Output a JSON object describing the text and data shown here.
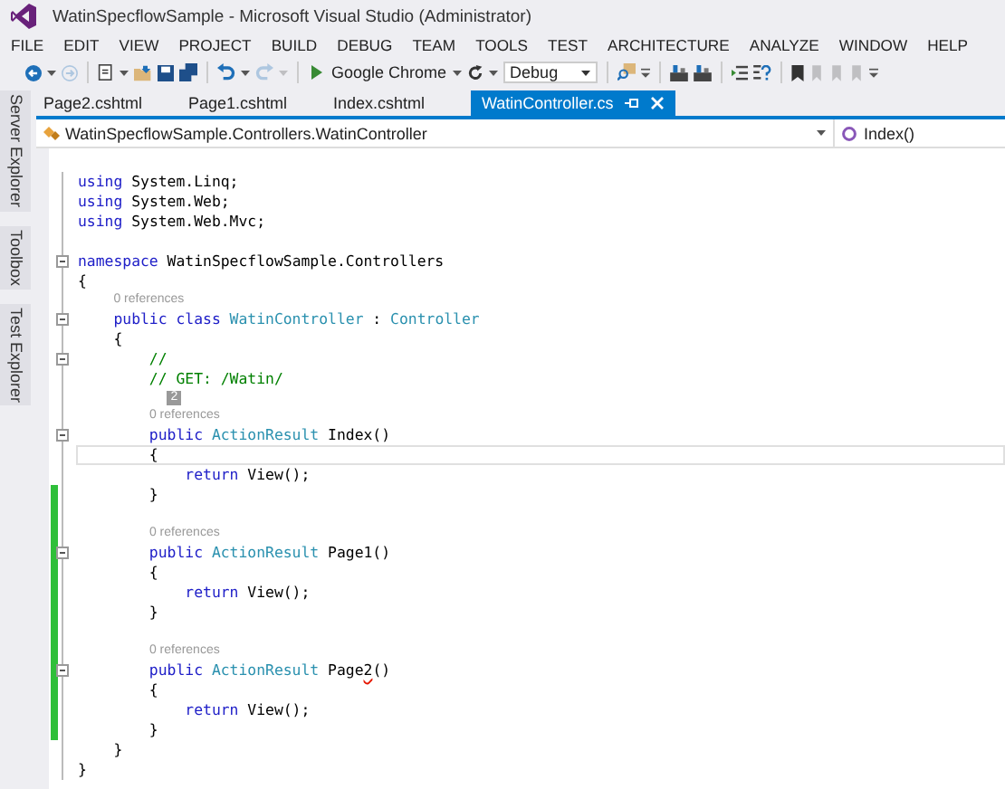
{
  "window": {
    "title": "WatinSpecflowSample - Microsoft Visual Studio (Administrator)"
  },
  "menu": [
    "FILE",
    "EDIT",
    "VIEW",
    "PROJECT",
    "BUILD",
    "DEBUG",
    "TEAM",
    "TOOLS",
    "TEST",
    "ARCHITECTURE",
    "ANALYZE",
    "WINDOW",
    "HELP"
  ],
  "toolbar": [
    {
      "kind": "back",
      "disabled": false
    },
    {
      "kind": "caret",
      "disabled": false
    },
    {
      "kind": "forward",
      "disabled": true
    },
    {
      "kind": "sep"
    },
    {
      "kind": "new",
      "disabled": false
    },
    {
      "kind": "caret",
      "disabled": false
    },
    {
      "kind": "open",
      "disabled": false
    },
    {
      "kind": "save",
      "disabled": false
    },
    {
      "kind": "saveall",
      "disabled": false
    },
    {
      "kind": "sep"
    },
    {
      "kind": "undo",
      "disabled": false
    },
    {
      "kind": "caret",
      "disabled": false
    },
    {
      "kind": "redo",
      "disabled": true
    },
    {
      "kind": "caret",
      "disabled": true
    },
    {
      "kind": "sep"
    },
    {
      "kind": "start",
      "label": "Google Chrome"
    },
    {
      "kind": "caret",
      "disabled": false
    },
    {
      "kind": "refresh",
      "disabled": false
    },
    {
      "kind": "caret",
      "disabled": false
    },
    {
      "kind": "combo",
      "value": "Debug"
    },
    {
      "kind": "sep"
    },
    {
      "kind": "find",
      "disabled": false
    },
    {
      "kind": "overflow",
      "disabled": false
    },
    {
      "kind": "sep"
    },
    {
      "kind": "tool",
      "disabled": false
    },
    {
      "kind": "tool",
      "disabled": false
    },
    {
      "kind": "sep"
    },
    {
      "kind": "indent",
      "disabled": false
    },
    {
      "kind": "help",
      "disabled": false
    },
    {
      "kind": "sep"
    },
    {
      "kind": "bookmark",
      "disabled": false
    },
    {
      "kind": "bookmarknav",
      "disabled": true
    },
    {
      "kind": "bookmarknav",
      "disabled": true
    },
    {
      "kind": "bookmarknav",
      "disabled": true
    },
    {
      "kind": "overflow",
      "disabled": false
    }
  ],
  "side_tabs": [
    "Server Explorer",
    "Toolbox",
    "Test Explorer"
  ],
  "tabs": [
    {
      "label": "Page2.cshtml",
      "selected": false
    },
    {
      "label": "Page1.cshtml",
      "selected": false
    },
    {
      "label": "Index.cshtml",
      "selected": false
    },
    {
      "label": "WatinController.cs",
      "selected": true
    }
  ],
  "nav_bar": {
    "type": "WatinSpecflowSample.Controllers.WatinController",
    "member": "Index()"
  },
  "code": [
    {
      "kind": "code",
      "fold": false,
      "changed": false,
      "current": false,
      "tokens": [
        {
          "text": "using",
          "kind": "keyword"
        },
        {
          "text": " System.Linq;",
          "kind": "plain"
        }
      ]
    },
    {
      "kind": "code",
      "fold": false,
      "changed": false,
      "current": false,
      "tokens": [
        {
          "text": "using",
          "kind": "keyword"
        },
        {
          "text": " System.Web;",
          "kind": "plain"
        }
      ]
    },
    {
      "kind": "code",
      "fold": false,
      "changed": false,
      "current": false,
      "tokens": [
        {
          "text": "using",
          "kind": "keyword"
        },
        {
          "text": " System.Web.Mvc;",
          "kind": "plain"
        }
      ]
    },
    {
      "kind": "blank",
      "fold": false,
      "changed": false,
      "current": false
    },
    {
      "kind": "code",
      "fold": true,
      "changed": false,
      "current": false,
      "tokens": [
        {
          "text": "namespace",
          "kind": "keyword"
        },
        {
          "text": " WatinSpecflowSample.Controllers",
          "kind": "plain"
        }
      ]
    },
    {
      "kind": "code",
      "fold": false,
      "changed": false,
      "current": false,
      "tokens": [
        {
          "text": "{",
          "kind": "plain"
        }
      ]
    },
    {
      "kind": "lens",
      "fold": false,
      "changed": false,
      "current": false,
      "tokens": [
        {
          "text": "    0 references",
          "kind": "lens"
        }
      ]
    },
    {
      "kind": "code",
      "fold": true,
      "changed": false,
      "current": false,
      "tokens": [
        {
          "text": "    public class",
          "kind": "keyword"
        },
        {
          "text": " WatinController",
          "kind": "type"
        },
        {
          "text": " : ",
          "kind": "plain"
        },
        {
          "text": "Controller",
          "kind": "type"
        }
      ]
    },
    {
      "kind": "code",
      "fold": false,
      "changed": false,
      "current": false,
      "tokens": [
        {
          "text": "    {",
          "kind": "plain"
        }
      ]
    },
    {
      "kind": "code",
      "fold": true,
      "changed": false,
      "current": false,
      "tokens": [
        {
          "text": "        //",
          "kind": "comment"
        }
      ]
    },
    {
      "kind": "code",
      "fold": false,
      "changed": false,
      "current": false,
      "tokens": [
        {
          "text": "        // GET: /Watin/",
          "kind": "comment"
        }
      ]
    },
    {
      "kind": "lens",
      "fold": false,
      "changed": false,
      "current": false,
      "tokens": [
        {
          "text": "          2",
          "kind": "badge"
        }
      ]
    },
    {
      "kind": "lens",
      "fold": false,
      "changed": false,
      "current": false,
      "tokens": [
        {
          "text": "        0 references",
          "kind": "lens"
        }
      ]
    },
    {
      "kind": "code",
      "fold": true,
      "changed": false,
      "current": false,
      "tokens": [
        {
          "text": "        public",
          "kind": "keyword"
        },
        {
          "text": " ActionResult",
          "kind": "type"
        },
        {
          "text": " Index()",
          "kind": "plain"
        }
      ]
    },
    {
      "kind": "code",
      "fold": false,
      "changed": false,
      "current": true,
      "tokens": [
        {
          "text": "        {",
          "kind": "plain"
        }
      ]
    },
    {
      "kind": "code",
      "fold": false,
      "changed": false,
      "current": false,
      "tokens": [
        {
          "text": "            return",
          "kind": "keyword"
        },
        {
          "text": " View();",
          "kind": "plain"
        }
      ]
    },
    {
      "kind": "code",
      "fold": false,
      "changed": true,
      "current": false,
      "tokens": [
        {
          "text": "        }",
          "kind": "plain"
        }
      ]
    },
    {
      "kind": "blank",
      "fold": false,
      "changed": true,
      "current": false
    },
    {
      "kind": "lens",
      "fold": false,
      "changed": true,
      "current": false,
      "tokens": [
        {
          "text": "        0 references",
          "kind": "lens"
        }
      ]
    },
    {
      "kind": "code",
      "fold": true,
      "changed": true,
      "current": false,
      "tokens": [
        {
          "text": "        public",
          "kind": "keyword"
        },
        {
          "text": " ActionResult",
          "kind": "type"
        },
        {
          "text": " Page1()",
          "kind": "plain"
        }
      ]
    },
    {
      "kind": "code",
      "fold": false,
      "changed": true,
      "current": false,
      "tokens": [
        {
          "text": "        {",
          "kind": "plain"
        }
      ]
    },
    {
      "kind": "code",
      "fold": false,
      "changed": true,
      "current": false,
      "tokens": [
        {
          "text": "            return",
          "kind": "keyword"
        },
        {
          "text": " View();",
          "kind": "plain"
        }
      ]
    },
    {
      "kind": "code",
      "fold": false,
      "changed": true,
      "current": false,
      "tokens": [
        {
          "text": "        }",
          "kind": "plain"
        }
      ]
    },
    {
      "kind": "blank",
      "fold": false,
      "changed": true,
      "current": false
    },
    {
      "kind": "lens",
      "fold": false,
      "changed": true,
      "current": false,
      "tokens": [
        {
          "text": "        0 references",
          "kind": "lens"
        }
      ]
    },
    {
      "kind": "code",
      "fold": true,
      "changed": true,
      "current": false,
      "tokens": [
        {
          "text": "        public",
          "kind": "keyword"
        },
        {
          "text": " ActionResult",
          "kind": "type"
        },
        {
          "text": " Page",
          "kind": "plain"
        },
        {
          "text": "2",
          "kind": "error"
        },
        {
          "text": "()",
          "kind": "plain"
        }
      ]
    },
    {
      "kind": "code",
      "fold": false,
      "changed": true,
      "current": false,
      "tokens": [
        {
          "text": "        {",
          "kind": "plain"
        }
      ]
    },
    {
      "kind": "code",
      "fold": false,
      "changed": true,
      "current": false,
      "tokens": [
        {
          "text": "            return",
          "kind": "keyword"
        },
        {
          "text": " View();",
          "kind": "plain"
        }
      ]
    },
    {
      "kind": "code",
      "fold": false,
      "changed": true,
      "current": false,
      "tokens": [
        {
          "text": "        }",
          "kind": "plain"
        }
      ]
    },
    {
      "kind": "code",
      "fold": false,
      "changed": false,
      "current": false,
      "tokens": [
        {
          "text": "    }",
          "kind": "plain"
        }
      ]
    },
    {
      "kind": "code",
      "fold": false,
      "changed": false,
      "current": false,
      "tokens": [
        {
          "text": "}",
          "kind": "plain"
        }
      ]
    }
  ]
}
